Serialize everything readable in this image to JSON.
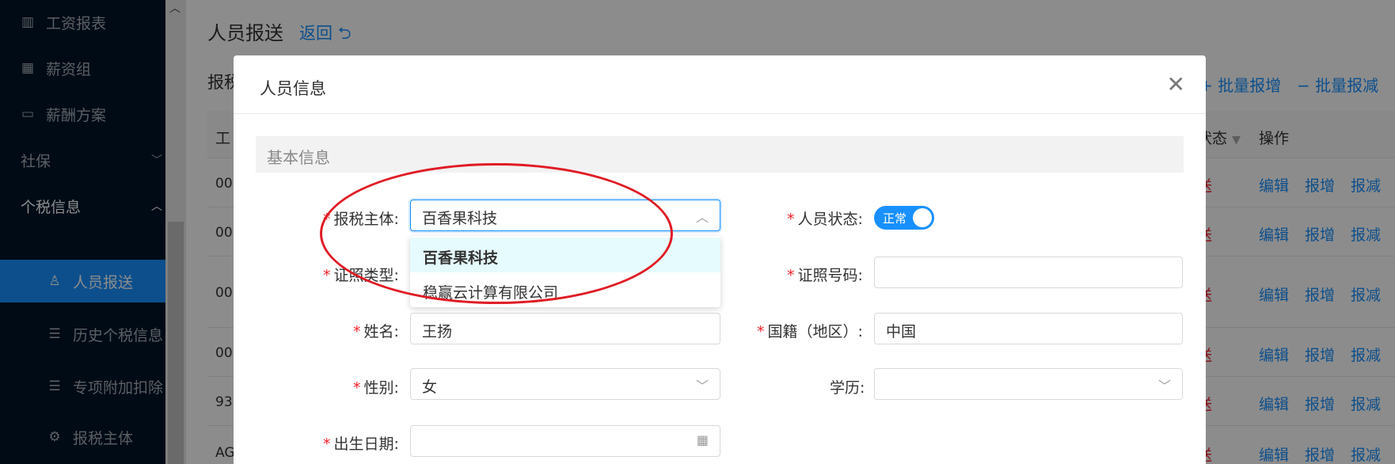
{
  "sidebar": {
    "items": [
      {
        "label": "工资报表",
        "icon": "bar-chart-icon"
      },
      {
        "label": "薪资组",
        "icon": "grid-icon"
      },
      {
        "label": "薪酬方案",
        "icon": "wallet-icon"
      },
      {
        "label": "社保",
        "icon": "chevron-down-icon"
      },
      {
        "label": "个税信息",
        "icon": "chevron-up-icon"
      },
      {
        "label": "人员报送",
        "icon": "user-icon"
      },
      {
        "label": "历史个税信息",
        "icon": "list-icon"
      },
      {
        "label": "专项附加扣除",
        "icon": "list-icon"
      },
      {
        "label": "报税主体",
        "icon": "gear-icon"
      }
    ]
  },
  "page": {
    "title": "人员报送",
    "back": "返回",
    "subtitle": "报税",
    "batch_add": "批量报增",
    "batch_remove": "批量报减"
  },
  "table": {
    "col_first": "工",
    "col_status": "状态",
    "col_ops": "操作",
    "rows": [
      {
        "id": "00",
        "status": "送"
      },
      {
        "id": "00",
        "status": "送"
      },
      {
        "id": "00",
        "status": "送"
      },
      {
        "id": "00",
        "status": "送"
      },
      {
        "id": "93",
        "status": "送"
      },
      {
        "id": "AG",
        "status": "送"
      }
    ],
    "ops": {
      "edit": "编辑",
      "add": "报增",
      "remove": "报减"
    }
  },
  "modal": {
    "title": "人员信息",
    "section": "基本信息",
    "fields": {
      "tax_entity_label": "报税主体:",
      "tax_entity_value": "百香果科技",
      "staff_status_label": "人员状态:",
      "staff_status_value": "正常",
      "id_type_label": "证照类型:",
      "id_number_label": "证照号码:",
      "name_label": "姓名:",
      "name_value": "王扬",
      "nationality_label": "国籍（地区）:",
      "nationality_value": "中国",
      "gender_label": "性别:",
      "gender_value": "女",
      "education_label": "学历:",
      "birth_label": "出生日期:"
    },
    "dropdown_options": [
      "百香果科技",
      "稳赢云计算有限公司"
    ]
  }
}
